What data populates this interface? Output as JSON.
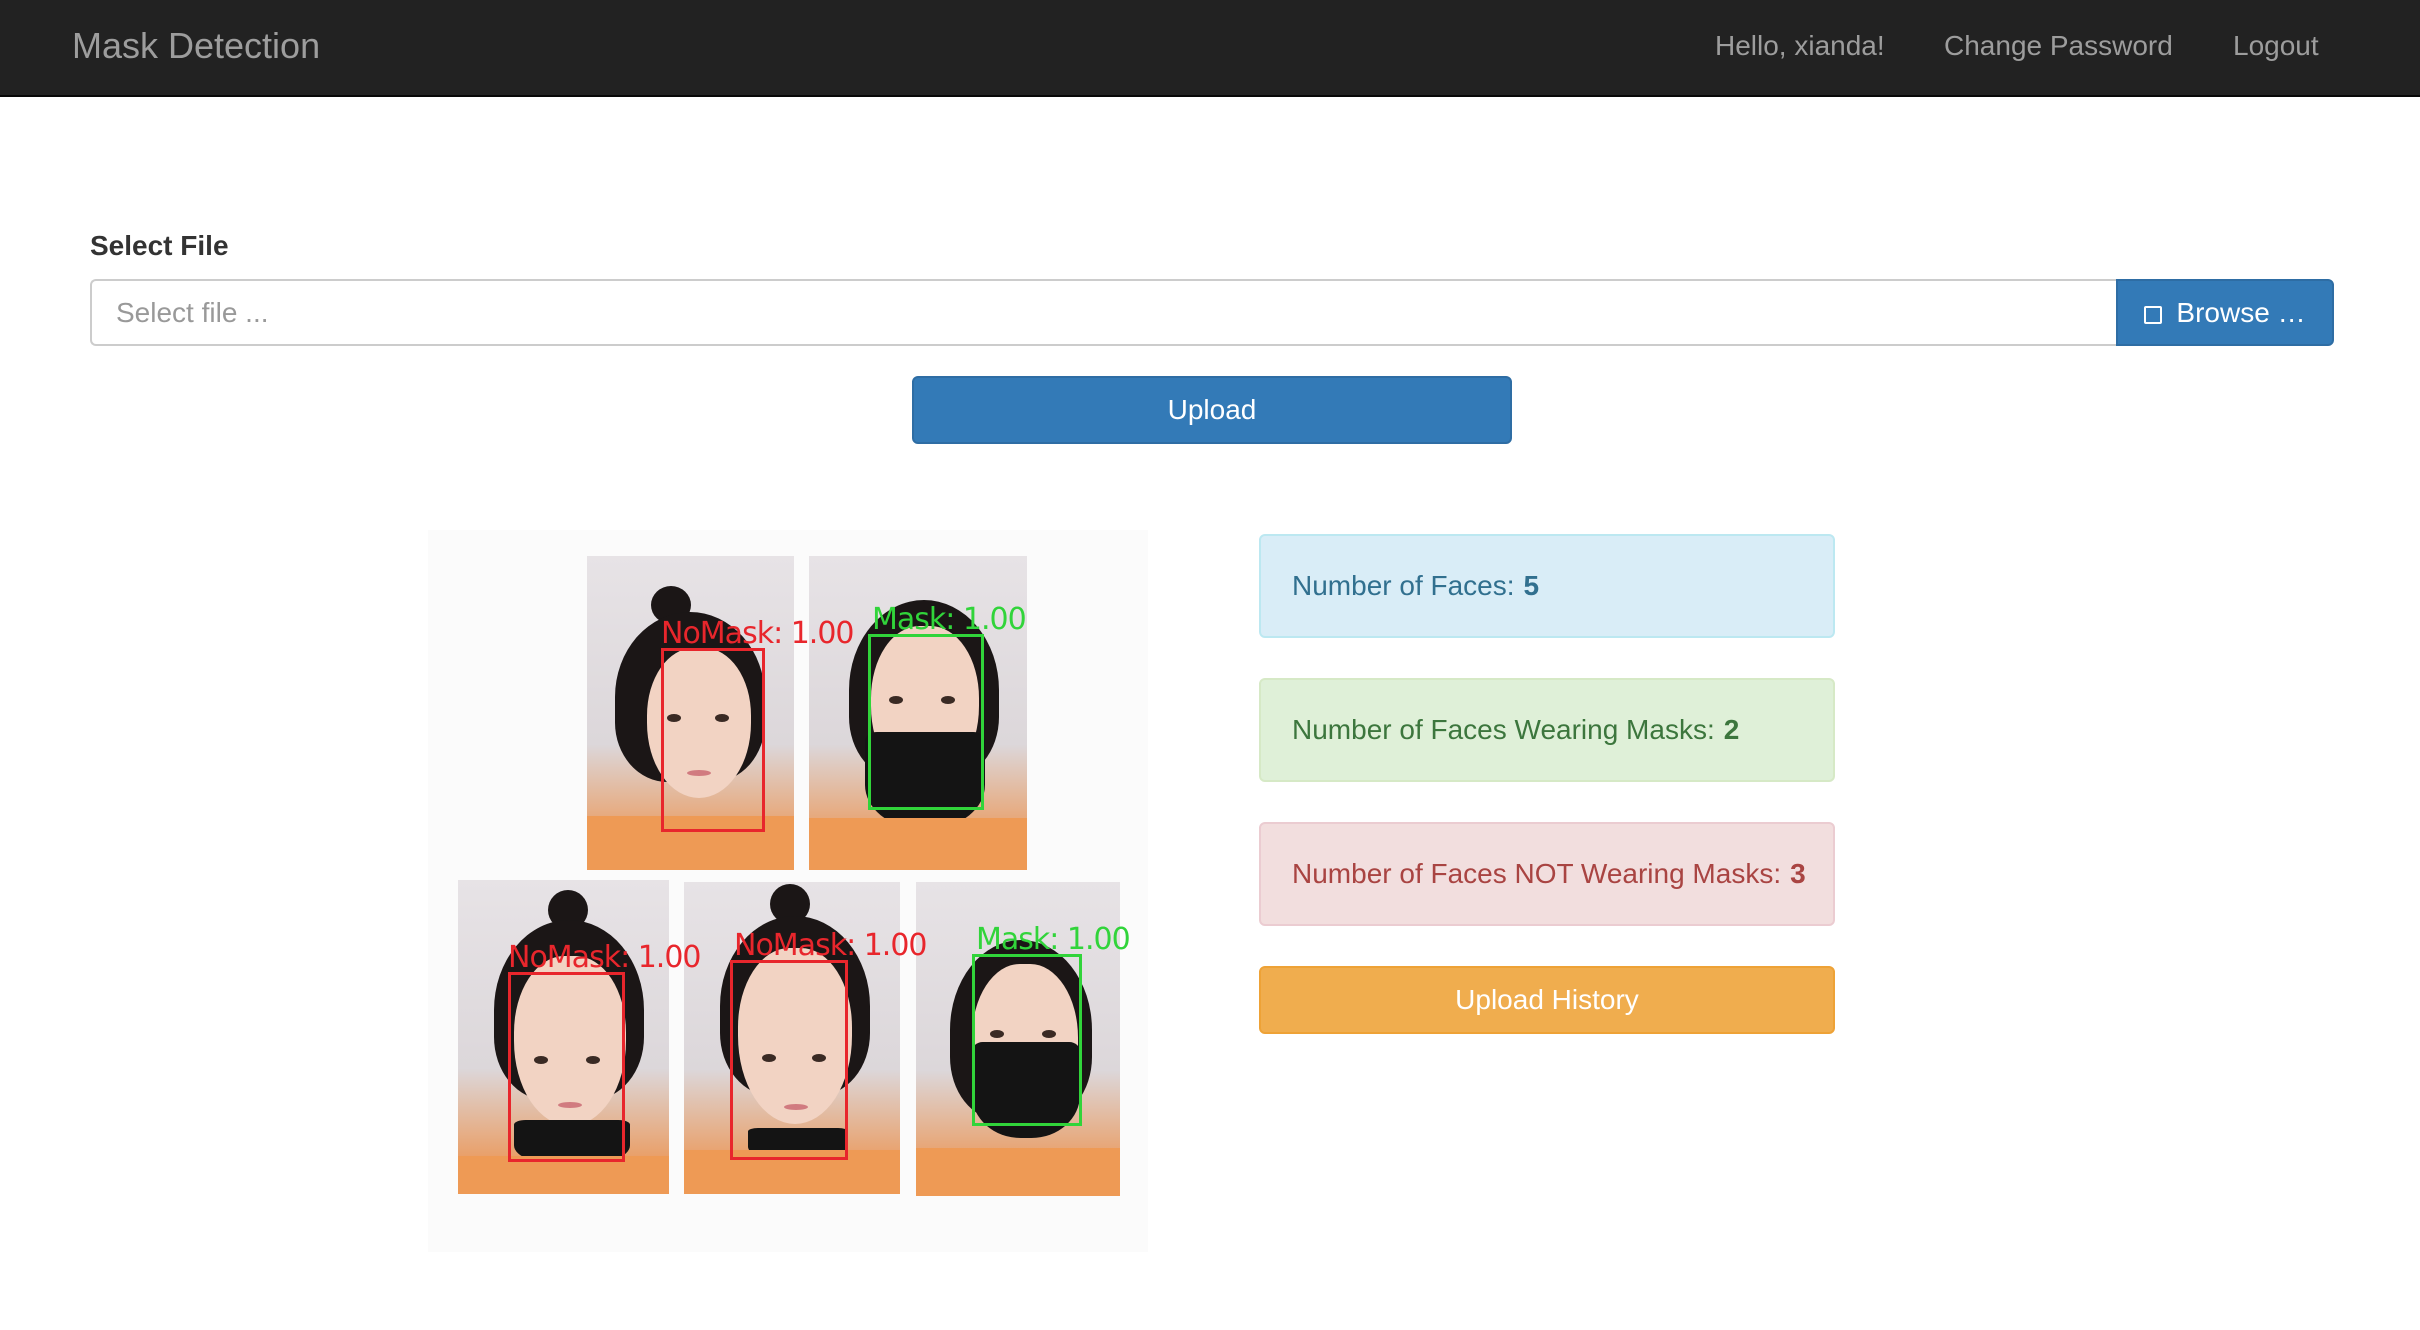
{
  "navbar": {
    "brand": "Mask Detection",
    "greeting": "Hello, xianda!",
    "change_password": "Change Password",
    "logout": "Logout"
  },
  "upload_form": {
    "label": "Select File",
    "placeholder": "Select file ...",
    "browse_label": "Browse …",
    "upload_label": "Upload"
  },
  "detections": [
    {
      "label": "NoMask: 1.00",
      "status": "no-mask",
      "color": "#e8262c"
    },
    {
      "label": "Mask: 1.00",
      "status": "mask",
      "color": "#31d43a"
    },
    {
      "label": "NoMask: 1.00",
      "status": "no-mask",
      "color": "#e8262c"
    },
    {
      "label": "NoMask: 1.00",
      "status": "no-mask",
      "color": "#e8262c"
    },
    {
      "label": "Mask: 1.00",
      "status": "mask",
      "color": "#31d43a"
    }
  ],
  "stats": {
    "faces_label": "Number of Faces:",
    "faces_value": "5",
    "masks_label": "Number of Faces Wearing Masks:",
    "masks_value": "2",
    "no_masks_label": "Number of Faces NOT Wearing Masks:",
    "no_masks_value": "3"
  },
  "history_button": "Upload History",
  "colors": {
    "navbar_bg": "#222222",
    "primary": "#337ab7",
    "warning": "#f0ad4e",
    "info_bg": "#d9edf7",
    "success_bg": "#dff0d8",
    "danger_bg": "#f2dede"
  }
}
